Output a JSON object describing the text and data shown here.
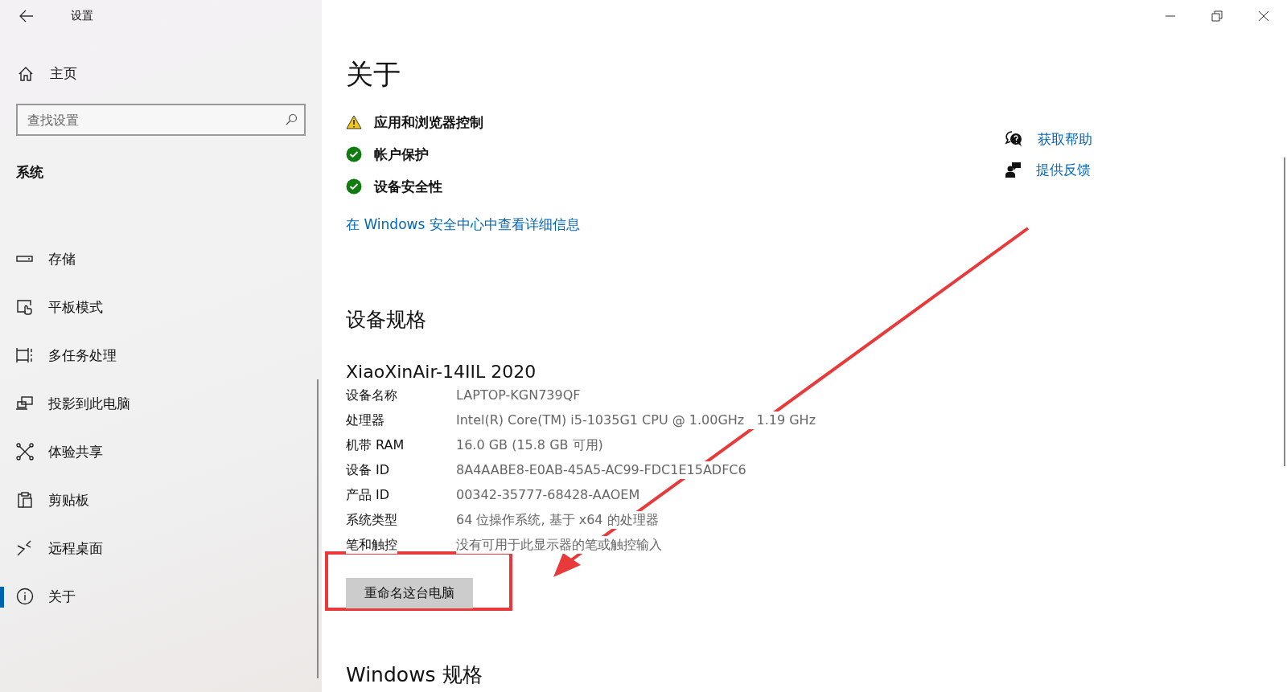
{
  "window": {
    "title": "设置"
  },
  "sidebar": {
    "home": "主页",
    "search": {
      "placeholder": "查找设置"
    },
    "section": "系统",
    "items": [
      {
        "label": "存储",
        "kind": "storage",
        "selected": false
      },
      {
        "label": "平板模式",
        "kind": "tablet",
        "selected": false
      },
      {
        "label": "多任务处理",
        "kind": "multitask",
        "selected": false
      },
      {
        "label": "投影到此电脑",
        "kind": "project",
        "selected": false
      },
      {
        "label": "体验共享",
        "kind": "share",
        "selected": false
      },
      {
        "label": "剪贴板",
        "kind": "clipboard",
        "selected": false
      },
      {
        "label": "远程桌面",
        "kind": "remote",
        "selected": false
      },
      {
        "label": "关于",
        "kind": "info",
        "selected": true
      }
    ]
  },
  "page": {
    "title": "关于",
    "security": [
      {
        "label": "应用和浏览器控制",
        "kind": "warning"
      },
      {
        "label": "帐户保护",
        "kind": "ok"
      },
      {
        "label": "设备安全性",
        "kind": "ok"
      }
    ],
    "security_link": "在 Windows 安全中心中查看详细信息",
    "specs_title": "设备规格",
    "model": "XiaoXinAir-14IIL 2020",
    "specs": [
      {
        "label": "设备名称",
        "value": "LAPTOP-KGN739QF"
      },
      {
        "label": "处理器",
        "value": "Intel(R) Core(TM) i5-1035G1 CPU @ 1.00GHz   1.19 GHz"
      },
      {
        "label": "机带 RAM",
        "value": "16.0 GB (15.8 GB 可用)"
      },
      {
        "label": "设备 ID",
        "value": "8A4AABE8-E0AB-45A5-AC99-FDC1E15ADFC6"
      },
      {
        "label": "产品 ID",
        "value": "00342-35777-68428-AAOEM"
      },
      {
        "label": "系统类型",
        "value": "64 位操作系统, 基于 x64 的处理器"
      },
      {
        "label": "笔和触控",
        "value": "没有可用于此显示器的笔或触控输入"
      }
    ],
    "rename_button": "重命名这台电脑",
    "windows_title": "Windows 规格"
  },
  "help_links": [
    {
      "label": "获取帮助",
      "kind": "help"
    },
    {
      "label": "提供反馈",
      "kind": "feedback"
    }
  ]
}
